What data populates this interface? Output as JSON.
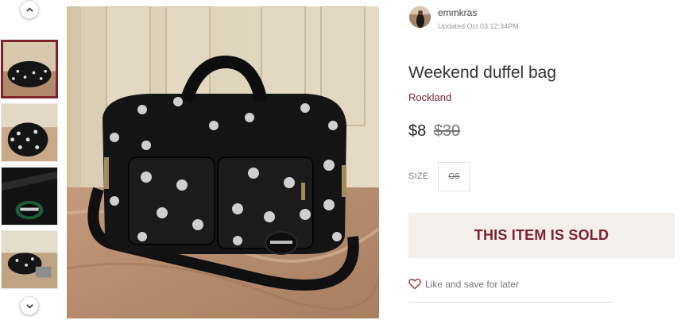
{
  "gallery": {
    "prev_icon": "chevron-up-icon",
    "next_icon": "chevron-down-icon",
    "thumbnails": [
      {
        "label": "photo 1"
      },
      {
        "label": "photo 2"
      },
      {
        "label": "photo 3"
      },
      {
        "label": "photo 4"
      }
    ],
    "active_index": 0
  },
  "seller": {
    "username": "emmkras",
    "updated": "Updated Oct 03 12:34PM"
  },
  "listing": {
    "title": "Weekend duffel bag",
    "location": "Rockland",
    "price": "$8",
    "original_price": "$30",
    "size_label": "SIZE",
    "size_value": "OS",
    "sold_banner": "THIS ITEM IS SOLD",
    "like_label": "Like and save for later"
  },
  "colors": {
    "accent": "#7f2230",
    "sold_bg": "#f3f0ec"
  }
}
